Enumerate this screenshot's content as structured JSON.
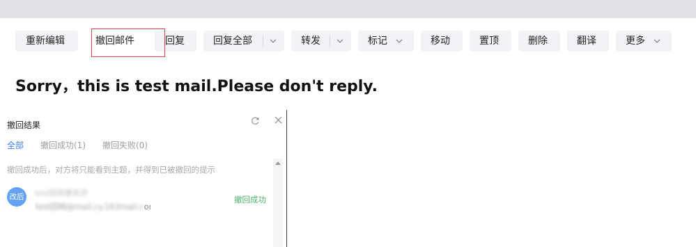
{
  "toolbar": {
    "buttons": [
      {
        "label": "重新编辑"
      },
      {
        "label": "撤回邮件"
      },
      {
        "label": "回复"
      },
      {
        "label": "回复全部"
      },
      {
        "label": "转发"
      },
      {
        "label": "标记"
      },
      {
        "label": "移动"
      },
      {
        "label": "置顶"
      },
      {
        "label": "删除"
      },
      {
        "label": "翻译"
      },
      {
        "label": "更多"
      }
    ]
  },
  "mail": {
    "subject": "Sorry，this is test mail.Please don't reply."
  },
  "recall_panel": {
    "title": "撤回结果",
    "tabs": [
      {
        "label": "全部",
        "active": true
      },
      {
        "label": "撤回成功(1)",
        "active": false
      },
      {
        "label": "撤回失败(0)",
        "active": false
      }
    ],
    "hint": "撤回成功后，对方将只能看到主题，并得到已被撤回的提示",
    "recipients": [
      {
        "avatar_text": "改后",
        "name": "test回响事务员",
        "email_hidden": "test回响@mail.cy.163mail.c",
        "email_visible": "om",
        "status": "撤回成功"
      }
    ]
  },
  "colors": {
    "accent": "#3d7be8",
    "success": "#4fb56c",
    "avatar": "#64a2f2",
    "highlight_border": "#d9434a"
  }
}
